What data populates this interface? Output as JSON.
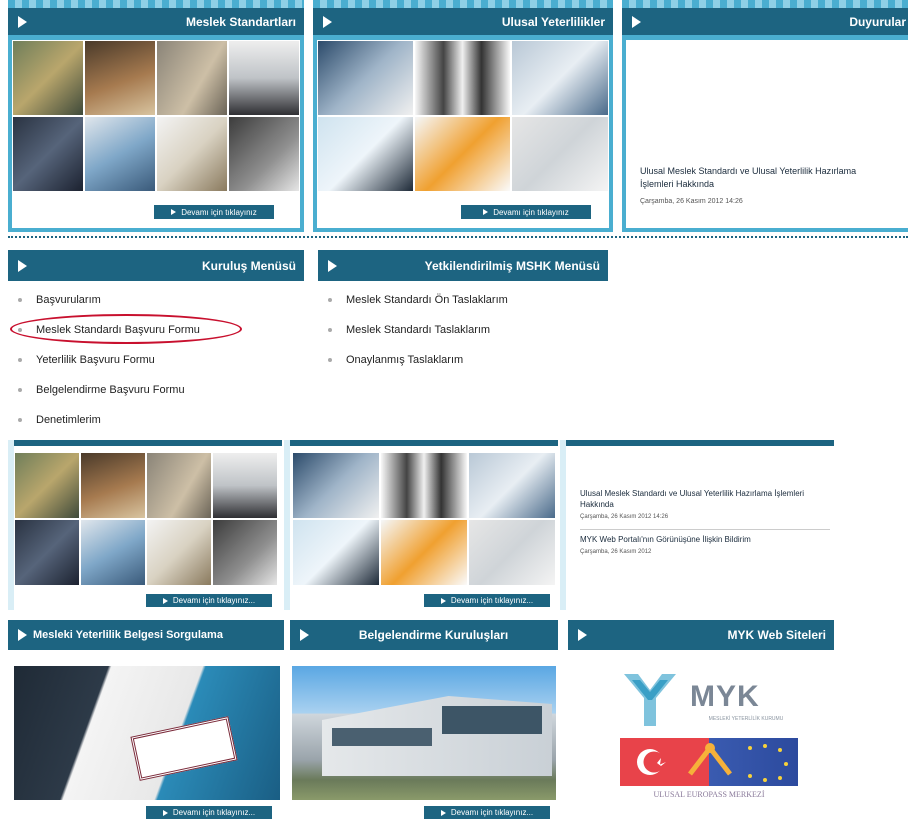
{
  "top": {
    "panel1": {
      "title": "Meslek Standartları",
      "button": "Devamı için tıklayınız"
    },
    "panel2": {
      "title": "Ulusal Yeterlilikler",
      "button": "Devamı için tıklayınız"
    },
    "panel3": {
      "title": "Duyurular",
      "news_title": "Ulusal Meslek Standardı ve Ulusal Yeterlilik Hazırlama İşlemleri Hakkında",
      "news_date": "Çarşamba, 26 Kasım 2012 14:26"
    }
  },
  "menus": {
    "kurulus": {
      "title": "Kuruluş Menüsü",
      "items": [
        "Başvurularım",
        "Meslek Standardı Başvuru Formu",
        "Yeterlilik Başvuru Formu",
        "Belgelendirme Başvuru Formu",
        "Denetimlerim"
      ]
    },
    "mshk": {
      "title": "Yetkilendirilmiş MSHK Menüsü",
      "items": [
        "Meslek Standardı Ön Taslaklarım",
        "Meslek Standardı Taslaklarım",
        "Onaylanmış Taslaklarım"
      ]
    }
  },
  "middle": {
    "btn1": "Devamı için tıklayınız...",
    "btn2": "Devamı için tıklayınız...",
    "news1_title": "Ulusal Meslek Standardı ve Ulusal Yeterlilik Hazırlama İşlemleri Hakkında",
    "news1_date": "Çarşamba, 26 Kasım 2012 14:26",
    "news2_title": "MYK Web Portalı'nın Görünüşüne İlişkin Bildirim",
    "news2_date": "Çarşamba, 26 Kasım 2012"
  },
  "bottom": {
    "panel1": {
      "title": "Mesleki Yeterlilik Belgesi Sorgulama",
      "button": "Devamı için tıklayınız..."
    },
    "panel2": {
      "title": "Belgelendirme Kuruluşları",
      "button": "Devamı için tıklayınız..."
    },
    "panel3": {
      "title": "MYK Web Siteleri",
      "myk_logo": "MYK",
      "myk_sub": "MESLEKİ YETERLİLİK KURUMU",
      "europass": "ULUSAL EUROPASS MERKEZİ"
    }
  },
  "colors": {
    "header": "#1d6481",
    "highlight_ring": "#c8102e"
  }
}
